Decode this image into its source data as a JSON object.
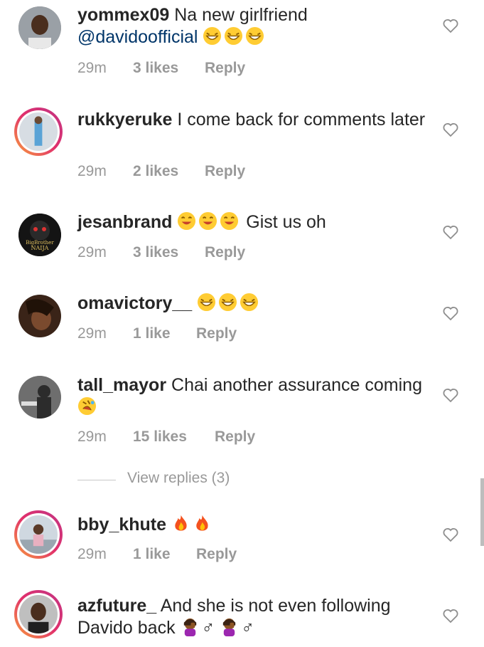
{
  "comments": [
    {
      "username": "yommex09",
      "text": "Na new girlfriend ",
      "mention": "@davidoofficial",
      "emoji": "laughing-emoji x3",
      "time": "29m",
      "likes": "3 likes",
      "reply": "Reply"
    },
    {
      "username": "rukkyeruke",
      "text": "I come back for comments later",
      "time": "29m",
      "likes": "2 likes",
      "reply": "Reply"
    },
    {
      "username": "jesanbrand",
      "text": "Gist us oh",
      "emoji": "grinning-emoji x3",
      "time": "29m",
      "likes": "3 likes",
      "reply": "Reply",
      "avatar_text_top": "BigBrother",
      "avatar_text_bottom": "NAIJA"
    },
    {
      "username": "omavictory__",
      "text": "",
      "emoji": "laughing-emoji x3",
      "time": "29m",
      "likes": "1 like",
      "reply": "Reply"
    },
    {
      "username": "tall_mayor",
      "text": "Chai another assurance coming",
      "emoji": "rofl-emoji",
      "time": "29m",
      "likes": "15 likes",
      "reply": "Reply"
    },
    {
      "username": "bby_khute",
      "text": "",
      "emoji": "fire-emoji x2",
      "time": "29m",
      "likes": "1 like",
      "reply": "Reply"
    },
    {
      "username": "azfuture_",
      "text": "And she is not even following Davido back",
      "emoji": "facepalm-emoji x2",
      "gender_symbol": "♂",
      "time": "",
      "likes": "",
      "reply": ""
    }
  ],
  "view_replies": "View replies (3)",
  "colors": {
    "text": "#262626",
    "meta": "#999999",
    "mention": "#003569",
    "story_ring": "#e1306c"
  }
}
